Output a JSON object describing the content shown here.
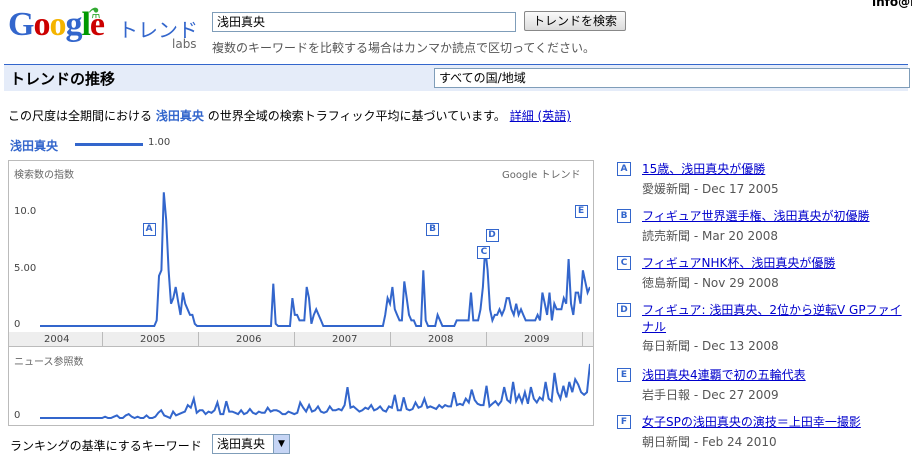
{
  "logo": {
    "text": "Google",
    "trend_word": "トレンド",
    "labs": "labs"
  },
  "user": {
    "email": "info@l"
  },
  "search": {
    "value": "浅田真央",
    "button": "トレンドを検索",
    "hint": "複数のキーワードを比較する場合はカンマか読点で区切ってください。"
  },
  "section": {
    "title": "トレンドの推移",
    "region": "すべての国/地域"
  },
  "scale_note": {
    "prefix": "この尺度は全期間における",
    "keyword": "浅田真央",
    "suffix": "の世界全域の検索トラフィック平均に基づいています。",
    "link": "詳細 (英語)"
  },
  "legend": {
    "keyword": "浅田真央",
    "value": "1.00"
  },
  "chart_data": [
    {
      "type": "line",
      "title": "検索数の指数",
      "watermark": "Google トレンド",
      "yticks": [
        "10.0",
        "5.00",
        "0"
      ],
      "ylim": [
        0,
        14
      ],
      "x_labels": [
        "2004",
        "2005",
        "2006",
        "2007",
        "2008",
        "2009"
      ],
      "series": [
        {
          "name": "浅田真央",
          "values": [
            0,
            0,
            0,
            0,
            0,
            0,
            0,
            0,
            0,
            0,
            0,
            0,
            0,
            0,
            0,
            0,
            0,
            0,
            0,
            0,
            0,
            0,
            0,
            0,
            0,
            0,
            0,
            0,
            0,
            0,
            0,
            0,
            0,
            0,
            0,
            0,
            0,
            0,
            0,
            0,
            0,
            0,
            0,
            0,
            0,
            0,
            0,
            0,
            0,
            0.5,
            4.5,
            5,
            12,
            9.5,
            5,
            2,
            2.5,
            3.5,
            2.2,
            1,
            3,
            2,
            1.5,
            1,
            1,
            0.2,
            0,
            0,
            0,
            0,
            0,
            0,
            0,
            0,
            0,
            0,
            0,
            0,
            0,
            0,
            0,
            0,
            0,
            0,
            0,
            0,
            0,
            0,
            0,
            0,
            0,
            0,
            0,
            0,
            0,
            0,
            0,
            0,
            3.8,
            0.2,
            0,
            0,
            0,
            0,
            0,
            0,
            2.5,
            1,
            1,
            0.5,
            0.5,
            0.5,
            3.5,
            2.5,
            0.2,
            1,
            1.5,
            1,
            0.5,
            0,
            0,
            0,
            0,
            0,
            0,
            0,
            0,
            0,
            0,
            0,
            0,
            0,
            0,
            0,
            0,
            0,
            0,
            0,
            0,
            0,
            0,
            0,
            0,
            0,
            0,
            1,
            2.5,
            2,
            3.5,
            1.5,
            1,
            0.5,
            0.5,
            4,
            2.5,
            1,
            0.5,
            0.5,
            0,
            0,
            0,
            5,
            0.5,
            0,
            0,
            0,
            0,
            1,
            0.5,
            0,
            0,
            0,
            0,
            0,
            0,
            0.5,
            0.5,
            0.5,
            0.5,
            0.5,
            0.5,
            3,
            0.5,
            0.5,
            0.5,
            1.5,
            3.5,
            7,
            5,
            1.5,
            0.5,
            1,
            1,
            1.5,
            1,
            1.5,
            2.5,
            2.5,
            1.5,
            1,
            2,
            1,
            1.5,
            1,
            0.5,
            0.5,
            0.5,
            0.5,
            0.5,
            1,
            0.5,
            3,
            2,
            1,
            3,
            0.5,
            2,
            1.5,
            1.5,
            1.5,
            2.5,
            2,
            6,
            2,
            1,
            3,
            3,
            2,
            5,
            4,
            3,
            3.5
          ]
        }
      ],
      "markers": [
        {
          "label": "A",
          "position": 0.19
        },
        {
          "label": "B",
          "position": 0.715
        },
        {
          "label": "C",
          "position": 0.81
        },
        {
          "label": "D",
          "position": 0.825
        },
        {
          "label": "E",
          "position": 0.99
        }
      ]
    },
    {
      "type": "line",
      "title": "ニュース参照数",
      "yticks": [
        "0"
      ],
      "series": [
        {
          "name": "ニュース参照数",
          "values": [
            0,
            0,
            0,
            0,
            0,
            0,
            0,
            0,
            0,
            0,
            0,
            0,
            0,
            0,
            0,
            0,
            0,
            0,
            0,
            0,
            0,
            0,
            0.1,
            0,
            0,
            0.1,
            0.2,
            0,
            0,
            0.2,
            0.3,
            0.1,
            0,
            0.1,
            0,
            0,
            0.2,
            0,
            0,
            0.1,
            0.4,
            0.6,
            0.2,
            0.1,
            0,
            0.5,
            0.2,
            0.3,
            0.4,
            0.5,
            1,
            0.8,
            1.5,
            0.4,
            0.6,
            0.6,
            0.3,
            0.5,
            0.4,
            0.6,
            1.2,
            0.3,
            0.3,
            1.3,
            0.5,
            0.5,
            0.4,
            0.3,
            0.6,
            0.3,
            0.4,
            0.7,
            0.4,
            0.3,
            0.5,
            0.4,
            0.4,
            0.8,
            0.5,
            0.6,
            0.6,
            0.5,
            0.3,
            0.3,
            0.5,
            0.4,
            0.3,
            0.4,
            1.2,
            0.8,
            0.5,
            1,
            0.5,
            0.6,
            0.9,
            0.5,
            0.4,
            0.5,
            0.9,
            0.6,
            0.6,
            0.7,
            0.6,
            1,
            2.4,
            0.8,
            0.9,
            0.7,
            0.5,
            0.6,
            0.8,
            0.7,
            1,
            0.6,
            0.7,
            0.9,
            0.6,
            0.5,
            0.9,
            0.8,
            1.8,
            0.6,
            0.6,
            1.6,
            0.7,
            0.6,
            0.7,
            1.2,
            0.8,
            0.9,
            1.5,
            0.8,
            0.9,
            0.8,
            0.7,
            1,
            0.8,
            1,
            0.9,
            0.9,
            2,
            1,
            1.1,
            1,
            1.5,
            1.2,
            2.2,
            1.4,
            1.1,
            1,
            1,
            2.5,
            0.9,
            1.1,
            1.3,
            1,
            1.3,
            2.4,
            1.4,
            1.2,
            2.8,
            1.3,
            1.8,
            1.2,
            2,
            1.1,
            2.4,
            1.5,
            1.2,
            1.6,
            1.4,
            2.8,
            1.5,
            1.3,
            3.5,
            2,
            1.5,
            2.5,
            1.6,
            2.8,
            2,
            3,
            2.6,
            2,
            1.8,
            2,
            4.2
          ]
        }
      ]
    }
  ],
  "news": [
    {
      "letter": "A",
      "title": "15歳、浅田真央が優勝",
      "meta": "愛媛新聞 - Dec 17 2005"
    },
    {
      "letter": "B",
      "title": "フィギュア世界選手権、浅田真央が初優勝",
      "meta": "読売新聞 - Mar 20 2008"
    },
    {
      "letter": "C",
      "title": "フィギュアNHK杯、浅田真央が優勝",
      "meta": "徳島新聞 - Nov 29 2008"
    },
    {
      "letter": "D",
      "title": "フィギュア: 浅田真央、2位から逆転V GPファイナル",
      "meta": "毎日新聞 - Dec 13 2008"
    },
    {
      "letter": "E",
      "title": "浅田真央4連覇で初の五輪代表",
      "meta": "岩手日報 - Dec 27 2009"
    },
    {
      "letter": "F",
      "title": "女子SPの浅田真央の演技＝上田幸一撮影",
      "meta": "朝日新聞 - Feb 24 2010"
    }
  ],
  "ranking": {
    "label": "ランキングの基準にするキーワード",
    "selected": "浅田真央"
  },
  "colors": {
    "accent": "#3366cc",
    "link": "#0000cc",
    "bar_bg": "#e5ecf9"
  }
}
